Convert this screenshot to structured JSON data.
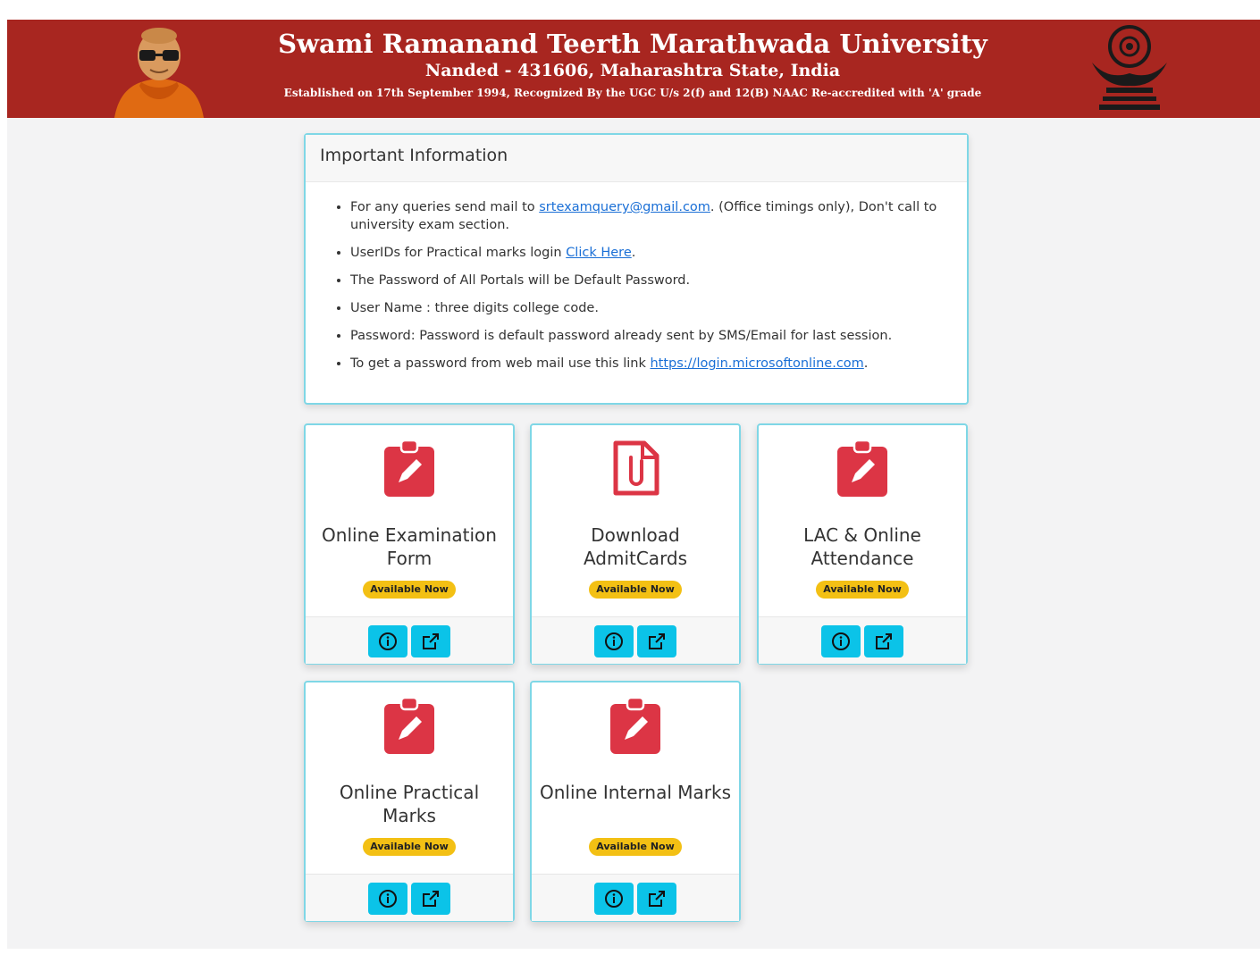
{
  "header": {
    "title": "Swami Ramanand Teerth Marathwada University",
    "address": "Nanded - 431606, Maharashtra State, India",
    "established": "Established on 17th September 1994, Recognized By the UGC U/s 2(f) and 12(B) NAAC Re-accredited with 'A' grade"
  },
  "info": {
    "heading": "Important Information",
    "item1_pre": "For any queries send mail to ",
    "item1_link": "srtexamquery@gmail.com",
    "item1_post": ". (Office timings only), Don't call to university exam section.",
    "item2_pre": "UserIDs for Practical marks login ",
    "item2_link": "Click Here",
    "item2_post": ".",
    "item3": "The Password of All Portals will be Default Password.",
    "item4": "User Name : three digits college code.",
    "item5": "Password: Password is default password already sent by SMS/Email for last session.",
    "item6_pre": "To get a password from web mail use this link ",
    "item6_link": "https://login.microsoftonline.com",
    "item6_post": "."
  },
  "cards": [
    {
      "title": "Online Examination Form",
      "badge": "Available Now",
      "icon": "clipboard-pencil-icon"
    },
    {
      "title": "Download AdmitCards",
      "badge": "Available Now",
      "icon": "file-clip-icon"
    },
    {
      "title": "LAC & Online Attendance",
      "badge": "Available Now",
      "icon": "clipboard-pencil-icon"
    },
    {
      "title": "Online Practical Marks",
      "badge": "Available Now",
      "icon": "clipboard-pencil-icon"
    },
    {
      "title": "Online Internal Marks",
      "badge": "Available Now",
      "icon": "clipboard-pencil-icon"
    }
  ],
  "colors": {
    "banner": "#a82620",
    "accent_border": "#7fd7e6",
    "icon_red": "#dc3545",
    "badge": "#f3c014",
    "button": "#0bc3e8"
  }
}
